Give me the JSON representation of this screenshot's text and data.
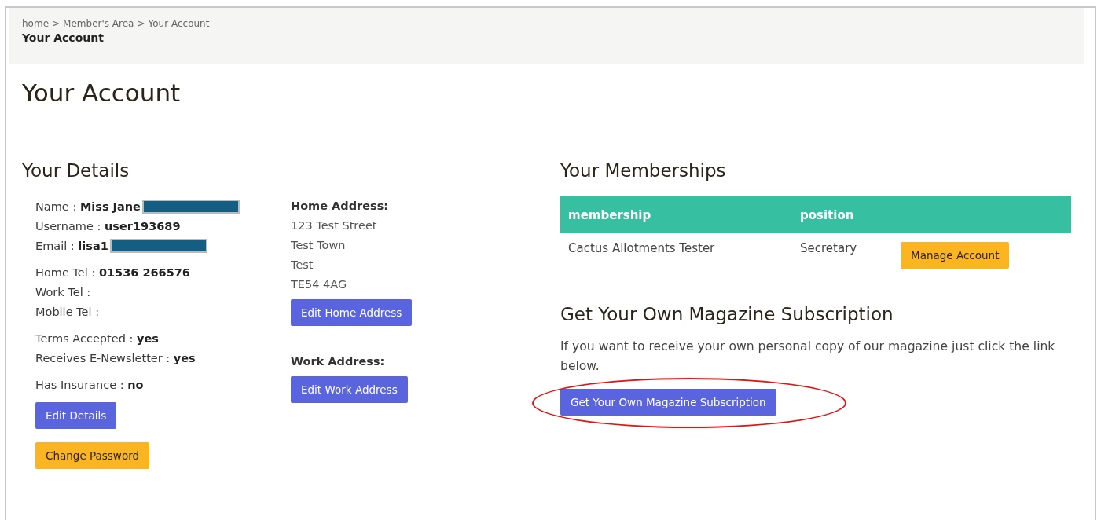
{
  "breadcrumb": {
    "items": [
      "home",
      "Member's Area",
      "Your Account"
    ],
    "separators": [
      ">",
      ">"
    ],
    "current": "Your Account"
  },
  "title": "Your Account",
  "details": {
    "heading": "Your Details",
    "groups": [
      [
        {
          "label": "Name :",
          "value": "Miss Jane",
          "redacted": true
        },
        {
          "label": "Username :",
          "value": "user193689"
        },
        {
          "label": "Email :",
          "value": "lisa1",
          "redacted": true
        }
      ],
      [
        {
          "label": "Home Tel :",
          "value": "01536 266576"
        },
        {
          "label": "Work Tel :"
        },
        {
          "label": "Mobile Tel :"
        }
      ],
      [
        {
          "label": "Terms Accepted :",
          "value": "yes"
        },
        {
          "label": "Receives E-Newsletter :",
          "value": "yes"
        }
      ],
      [
        {
          "label": "Has Insurance :",
          "value": "no"
        }
      ]
    ],
    "buttons": [
      {
        "label": "Edit Details",
        "kind": "primary"
      },
      {
        "label": "Change Password",
        "kind": "warning"
      }
    ]
  },
  "home_address": {
    "heading": "Home Address:",
    "lines": [
      "123 Test Street",
      "Test Town",
      "Test",
      "TE54 4AG"
    ],
    "button": "Edit Home Address"
  },
  "work_address": {
    "heading": "Work Address:",
    "button": "Edit Work Address"
  },
  "memberships": {
    "heading": "Your Memberships",
    "columns": [
      "membership",
      "position"
    ],
    "rows": [
      {
        "membership": "Cactus Allotments Tester",
        "position": "Secretary",
        "button": "Manage Account"
      }
    ]
  },
  "magazine": {
    "heading": "Get Your Own Magazine Subscription",
    "text": "If you want to receive your own personal copy of our magazine just click the link below.",
    "button": "Get Your Own Magazine Subscription",
    "circled": true
  }
}
